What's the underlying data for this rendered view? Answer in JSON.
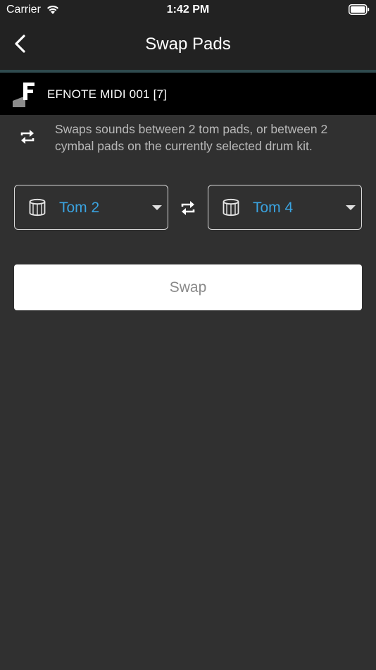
{
  "status_bar": {
    "carrier": "Carrier",
    "time": "1:42 PM",
    "icons": [
      "wifi-icon",
      "battery-icon"
    ]
  },
  "nav": {
    "back_icon": "chevron-left-icon",
    "title": "Swap Pads"
  },
  "device": {
    "logo_icon": "efnote-logo-icon",
    "name": "EFNOTE MIDI 001 [7]"
  },
  "info": {
    "icon": "swap-icon",
    "text": "Swaps sounds between 2 tom pads, or between 2 cymbal pads on the currently selected drum kit."
  },
  "pads": {
    "left": {
      "icon": "drum-icon",
      "value": "Tom 2"
    },
    "right": {
      "icon": "drum-icon",
      "value": "Tom 4"
    },
    "between_icon": "swap-arrows-icon"
  },
  "actions": {
    "swap_label": "Swap"
  },
  "colors": {
    "background": "#303030",
    "topbar": "#222222",
    "device_bar": "#000000",
    "accent_line": "#2f4a4e",
    "pad_value": "#3aa3e0",
    "info_text": "#b8b8b8",
    "button_bg": "#ffffff",
    "button_text": "#8a8a8a"
  }
}
